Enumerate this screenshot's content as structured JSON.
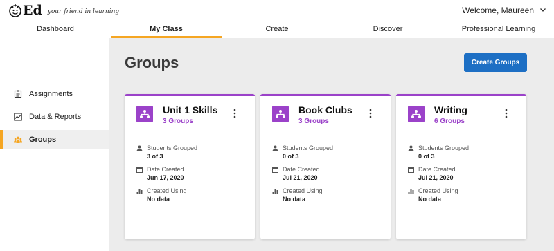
{
  "header": {
    "logo_text": "Ed",
    "tagline": "your friend in learning",
    "welcome": "Welcome, Maureen"
  },
  "nav": {
    "items": [
      "Dashboard",
      "My Class",
      "Create",
      "Discover",
      "Professional Learning"
    ],
    "active": "My Class"
  },
  "sidebar": {
    "items": [
      {
        "label": "Assignments",
        "icon": "clipboard-icon"
      },
      {
        "label": "Data & Reports",
        "icon": "chart-line-icon"
      },
      {
        "label": "Groups",
        "icon": "groups-icon"
      }
    ],
    "active": "Groups"
  },
  "main": {
    "title": "Groups",
    "create_button": "Create Groups",
    "cards": [
      {
        "title": "Unit 1 Skills",
        "subtitle": "3 Groups",
        "students_label": "Students Grouped",
        "students_value": "3 of 3",
        "date_label": "Date Created",
        "date_value": "Jun 17, 2020",
        "using_label": "Created Using",
        "using_value": "No data"
      },
      {
        "title": "Book Clubs",
        "subtitle": "3 Groups",
        "students_label": "Students Grouped",
        "students_value": "0 of 3",
        "date_label": "Date Created",
        "date_value": "Jul 21, 2020",
        "using_label": "Created Using",
        "using_value": "No data"
      },
      {
        "title": "Writing",
        "subtitle": "6 Groups",
        "students_label": "Students Grouped",
        "students_value": "0 of 3",
        "date_label": "Date Created",
        "date_value": "Jul 21, 2020",
        "using_label": "Created Using",
        "using_value": "No data"
      }
    ]
  },
  "colors": {
    "accent_orange": "#f5a623",
    "group_purple": "#9b42c9",
    "button_blue": "#1d6fc4"
  }
}
